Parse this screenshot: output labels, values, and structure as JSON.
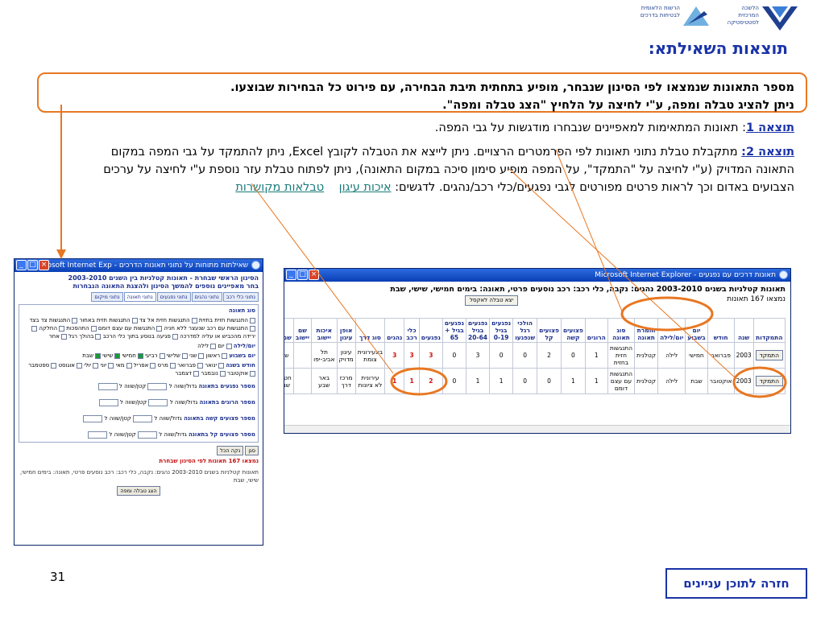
{
  "header": {
    "cbs_logo_text": [
      "הלשכה",
      "המרכזית",
      "לסטטיסטיקה"
    ],
    "rsa_logo_text": [
      "הרשות הלאומית",
      "לבטיחות בדרכים"
    ],
    "title": "תוצאות השאילתא:"
  },
  "intro": {
    "line1": "מספר התאונות שנמצאו לפי הסינון שנבחר, מופיע בתחתית תיבת הבחירה, עם פירוט כל הבחירות שבוצעו.",
    "line2": "ניתן להציג טבלה ומפה, ע\"י לחיצה על הלחיץ \"הצג טבלה ומפה\"."
  },
  "results": {
    "r1_label": "תוצאה 1",
    "r1_text": ": תאונות המתאימות למאפיינים שנבחרו מודגשות על גבי המפה.",
    "r2_label": "תוצאה 2:",
    "r2_text": " מתקבלת טבלת נתוני תאונות לפי הפרמטרים הרצויים. ניתן לייצא את הטבלה לקובץ Excel, ניתן להתמקד על גבי המפה במקום התאונה המדויק (ע\"י לחיצה על \"התמקד\", על המפה מופיע סימון סיכה במקום התאונה), ניתן לפתוח טבלת עזר נוספת ע\"י לחיצה על ערכים הצבועים באדום וכך לראות פרטים מפורטים לגבי נפגעים/כלי רכב/נהגים. לדגשים:",
    "link1": "איכות עיגון",
    "link2": "טבלאות מקושרות"
  },
  "left_window": {
    "title": "שאילתות מתוחות על נתוני תאונות הדרכים - Microsoft Internet Exp...",
    "heading1": "הסינון הראשי שבחרת - תאונות קטלניות בין השנים 2003-2010",
    "heading2": "בחר מאפיינים נוספים להמשך הסינון ולהצגת התאונה הנבחרות",
    "tabs": [
      "נתוני כלי רכב",
      "נתוני נהגים",
      "נתוני נפגעים",
      "נתוני תאונה",
      "נתוני מיקום"
    ],
    "accident_type_label": "סוג תאונה",
    "accident_types": [
      "התנגשות חזית בחזית",
      "התנגשות חזית אל צד",
      "התנגשות חזית באחור",
      "התנגשות צד בצד",
      "התנגשות עם רכב שנעצר ללא חניה",
      "התנגשות עם עצם דומם",
      "התהפכות",
      "החלקה",
      "ירידה מהכביש או עליה למדרכה",
      "פגיעה בנוסע בתוך כלי הרכב",
      "בהולך רגל",
      "אחר"
    ],
    "daynight_label": "יום/לילה",
    "daynight": [
      "יום",
      "לילה"
    ],
    "weekday_label": "יום בשבוע",
    "weekdays": [
      "ראשון",
      "שני",
      "שלישי",
      "רביעי",
      "חמישי",
      "שישי",
      "שבת"
    ],
    "month_label": "חודש בשנה",
    "months": [
      "ינואר",
      "פברואר",
      "מרס",
      "אפריל",
      "מאי",
      "יוני",
      "יולי",
      "אוגוסט",
      "ספטמבר",
      "אוקטובר",
      "נובמבר",
      "דצמבר"
    ],
    "range_rows": [
      "מספר נפגעים בתאונה",
      "מספר הרוגים בתאונה",
      "מספר פצועים קשה בתאונה",
      "מספר פצועים קל בתאונה"
    ],
    "range_from": "גדול/שווה ל",
    "range_to": "קטן/שווה ל",
    "btn_filter": "סנן",
    "btn_clear": "נקה הכל",
    "found_text": "נמצאו 167 תאונות לפי הסינון שבחרת",
    "summary": "תאונות קטלניות בשנים 2003-2010 נהגים: נקבה, כלי רכב: רכב נוסעים פרטי, תאונה: בימים חמישי, שישי, שבת",
    "btn_show": "הצג טבלה ומפה"
  },
  "main_window": {
    "title": "תאונות דרכים עם נפגעים - Microsoft Internet Explorer",
    "heading": "תאונות קטלניות בשנים 2003-2010 נהגים: נקבה, כלי רכב: רכב נוסעים פרטי, תאונה: בימים חמישי, שישי, שבת",
    "found": "נמצאו 167 תאונות",
    "excel_btn": "יצא טבלה לאקסל",
    "columns": [
      "התמקדות",
      "שנה",
      "חודש",
      "יום בשבוע",
      "יום/לילה",
      "חומרת תאונה",
      "סוג תאונה",
      "הרוגים",
      "פצועים קשה",
      "פצועים קל",
      "הולכי רגל שנפגעו",
      "נפגעים בגיל 0-19",
      "נפגעים בגיל 20-64",
      "נפגעים בגיל + 65",
      "נפגעים",
      "כלי רכב",
      "נהגים",
      "סוג דרך",
      "אופן עיגון",
      "איכות יישוב",
      "שם יישוב",
      "שם י"
    ],
    "rows": [
      {
        "btn": "התמקד",
        "cells": [
          "2003",
          "פברואר",
          "חמישי",
          "לילה",
          "קטלנית",
          "התנגשות חזית בחזית",
          "1",
          "0",
          "2",
          "0",
          "0",
          "3",
          "0",
          "3",
          "3",
          "3",
          "בינעירונית צומת",
          "עיגון מדויק",
          "תל אביב-יפו",
          "",
          "שד"
        ]
      },
      {
        "btn": "התמקד",
        "cells": [
          "2003",
          "אוקטובר",
          "שבת",
          "לילה",
          "קטלנית",
          "התנגשות עם עצם דומם",
          "1",
          "1",
          "0",
          "0",
          "1",
          "1",
          "0",
          "2",
          "1",
          "1",
          "עירונית לא ציונות",
          "מרכז דרך",
          "באר שבע",
          "",
          "חטיב שמו"
        ]
      }
    ]
  },
  "footer": {
    "page_number": "31",
    "back_button": "חזרה לתוכן עניינים"
  }
}
